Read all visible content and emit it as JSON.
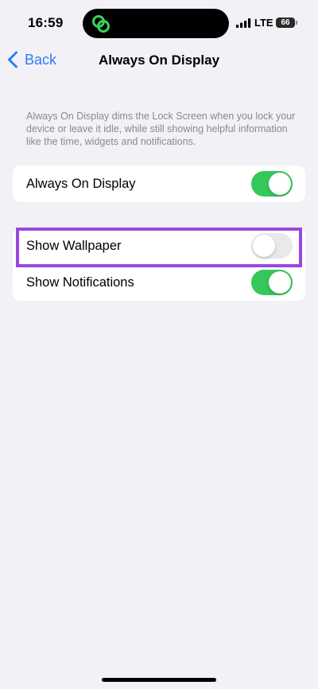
{
  "status_bar": {
    "time": "16:59",
    "network": "LTE",
    "battery": "66",
    "island_icon": "linked-rings-icon",
    "signal_icon": "cellular-signal-icon"
  },
  "nav": {
    "back_label": "Back",
    "back_icon": "chevron-left-icon",
    "title": "Always On Display"
  },
  "description": "Always On Display dims the Lock Screen when you lock your device or leave it idle, while still showing helpful information like the time, widgets and notifications.",
  "settings": {
    "always_on_display": {
      "label": "Always On Display",
      "enabled": true
    },
    "show_wallpaper": {
      "label": "Show Wallpaper",
      "enabled": false
    },
    "show_notifications": {
      "label": "Show Notifications",
      "enabled": true
    }
  },
  "colors": {
    "accent": "#2f7bf5",
    "toggle_on": "#34c759",
    "toggle_off": "#e9e9eb",
    "highlight": "#9a48e0",
    "island_icon": "#36d45e"
  }
}
